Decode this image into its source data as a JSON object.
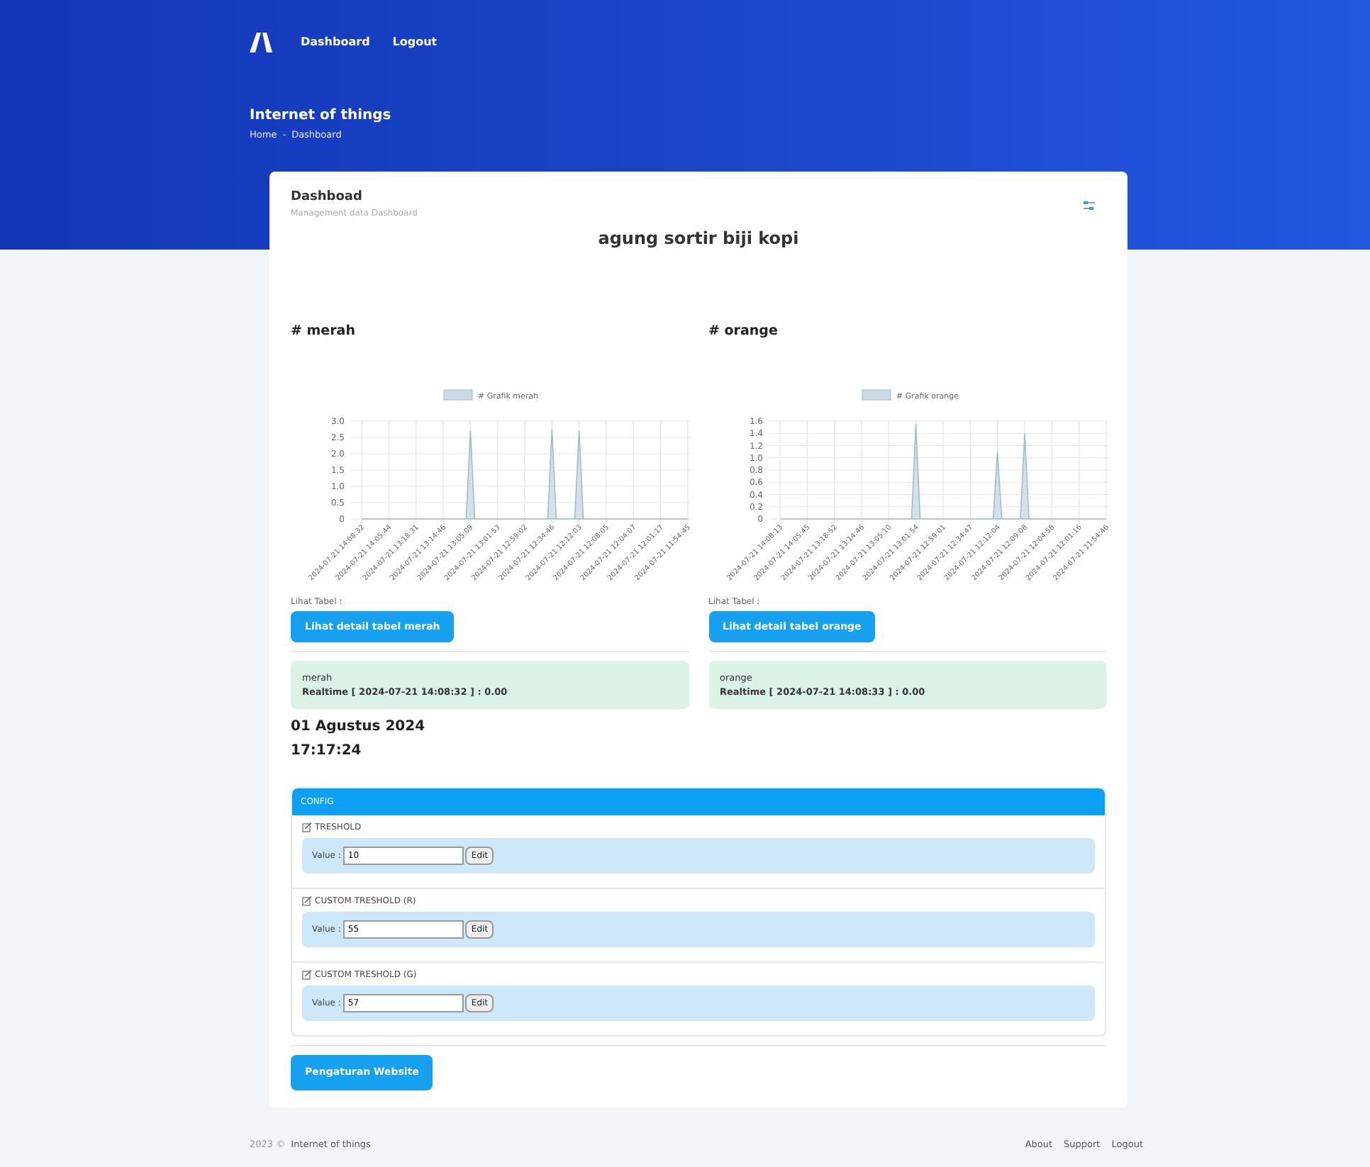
{
  "nav": {
    "links": [
      {
        "label": "Dashboard"
      },
      {
        "label": "Logout"
      }
    ]
  },
  "header": {
    "title": "Internet of things",
    "breadcrumb": [
      "Home",
      "-",
      "Dashboard"
    ]
  },
  "card": {
    "title": "Dashboad",
    "subtitle": "Management data Dashboard",
    "heading": "agung sortir biji kopi"
  },
  "panels": [
    {
      "title": "# merah",
      "table_label": "Lihat Tabel :",
      "button": "Lihat detail tabel merah",
      "realtime_name": "merah",
      "realtime_text": "Realtime [ 2024-07-21 14:08:32 ] : 0.00",
      "chart_data": {
        "type": "area",
        "categories": [
          "2024-07-21 14:08:32",
          "2024-07-21 14:05:44",
          "2024-07-21 13:18:31",
          "2024-07-21 13:14:46",
          "2024-07-21 13:05:09",
          "2024-07-21 13:01:53",
          "2024-07-21 12:59:02",
          "2024-07-21 12:34:46",
          "2024-07-21 12:12:03",
          "2024-07-21 12:08:05",
          "2024-07-21 12:04:07",
          "2024-07-21 12:01:17",
          "2024-07-21 11:54:45"
        ],
        "series": [
          {
            "name": "# Grafik merah",
            "color": "#c9dbe6",
            "values": [
              0,
              0,
              0,
              0,
              2.7,
              0,
              0,
              2.75,
              2.7,
              0,
              0,
              0,
              0
            ]
          }
        ],
        "grid": true,
        "ylim": [
          0,
          3
        ],
        "yticks": [
          0,
          0.5,
          {
            "value": 1,
            "label": "1.0"
          },
          1.5,
          {
            "value": 2,
            "label": "2.0"
          },
          2.5,
          {
            "value": 3,
            "label": "3.0"
          }
        ]
      }
    },
    {
      "title": "# orange",
      "table_label": "Lihat Tabel :",
      "button": "Lihat detail tabel orange",
      "realtime_name": "orange",
      "realtime_text": "Realtime [ 2024-07-21 14:08:33 ] : 0.00",
      "chart_data": {
        "type": "area",
        "categories": [
          "2024-07-21 14:08:13",
          "2024-07-21 14:05:45",
          "2024-07-21 13:18:52",
          "2024-07-21 13:14:46",
          "2024-07-21 13:05:10",
          "2024-07-21 13:01:54",
          "2024-07-21 12:59:01",
          "2024-07-21 12:34:47",
          "2024-07-21 12:12:04",
          "2024-07-21 12:09:08",
          "2024-07-21 12:04:58",
          "2024-07-21 12:01:16",
          "2024-07-21 11:54:46"
        ],
        "series": [
          {
            "name": "# Grafik orange",
            "color": "#c9dbe6",
            "values": [
              0,
              0,
              0,
              0,
              0,
              1.55,
              0,
              0,
              1.1,
              1.4,
              0,
              0,
              0
            ]
          }
        ],
        "grid": true,
        "ylim": [
          0,
          1.6
        ],
        "yticks": [
          0,
          0.2,
          0.4,
          0.6,
          0.8,
          {
            "value": 1,
            "label": "1.0"
          },
          1.2,
          1.4,
          1.6
        ]
      }
    }
  ],
  "date": "01 Agustus 2024",
  "time": "17:17:24",
  "config": {
    "title": "CONFIG",
    "items": [
      {
        "label": "TRESHOLD",
        "value_label": "Value :",
        "value": "10",
        "button": "Edit"
      },
      {
        "label": "CUSTOM TRESHOLD (R)",
        "value_label": "Value :",
        "value": "55",
        "button": "Edit"
      },
      {
        "label": "CUSTOM TRESHOLD (G)",
        "value_label": "Value :",
        "value": "57",
        "button": "Edit"
      }
    ]
  },
  "settings_button": "Pengaturan Website",
  "footer": {
    "copyright": "2023 ©",
    "site": "Internet of things",
    "links": [
      "About",
      "Support",
      "Logout"
    ]
  }
}
